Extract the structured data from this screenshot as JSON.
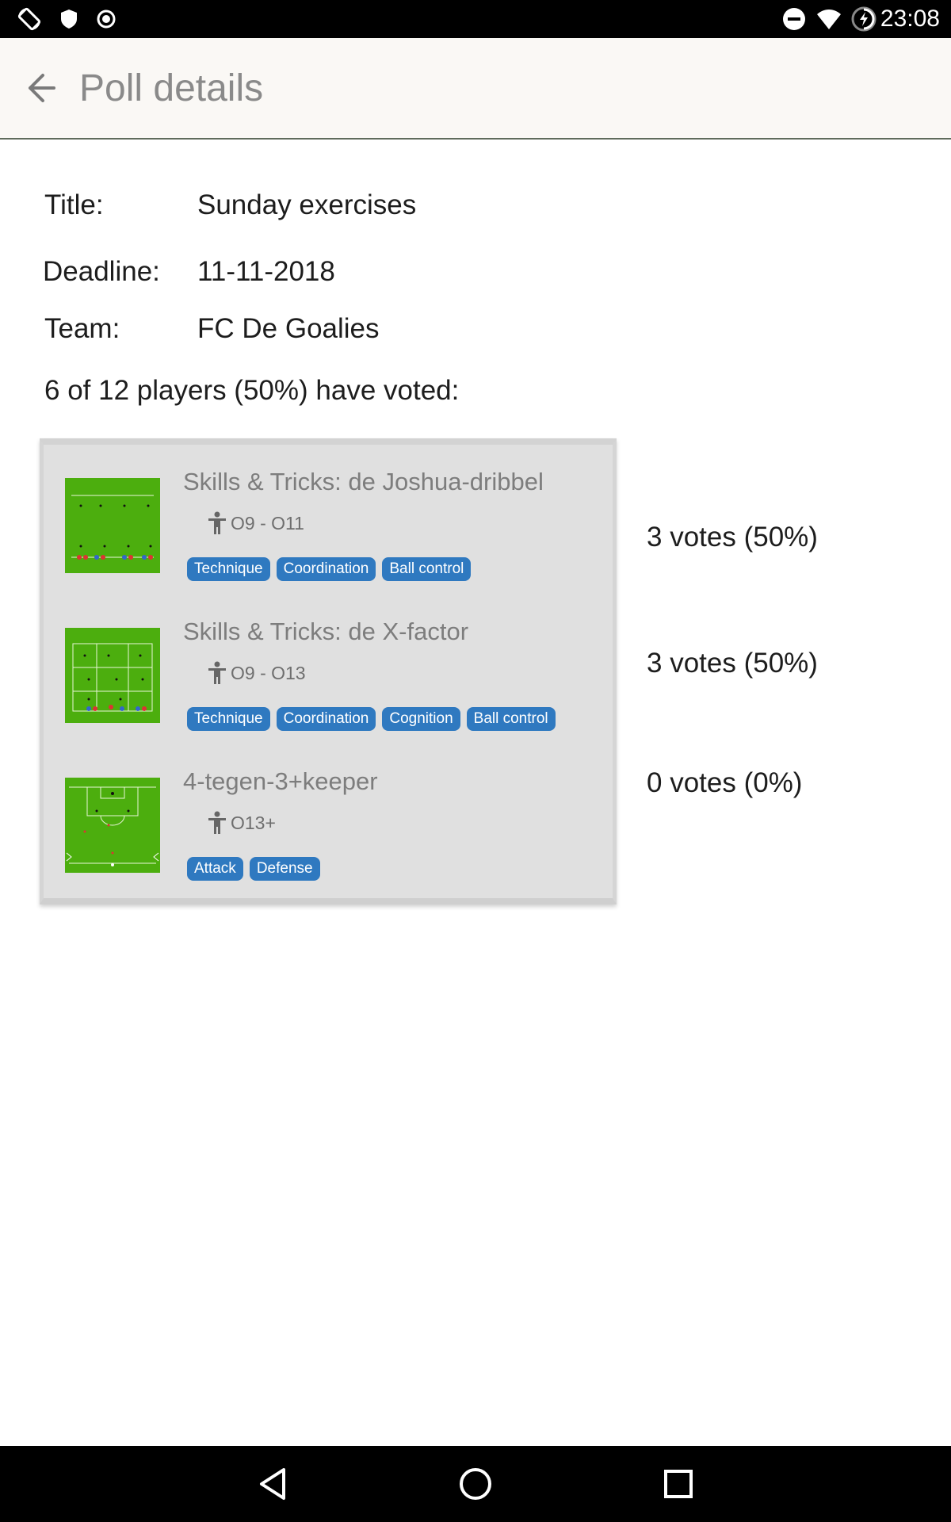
{
  "status_bar": {
    "time": "23:08",
    "icons": [
      "rotate-icon",
      "shield-icon",
      "record-icon",
      "do-not-disturb-icon",
      "wifi-icon",
      "battery-charging-icon"
    ]
  },
  "app_bar": {
    "title": "Poll details",
    "back_icon": "arrow-left-icon"
  },
  "details": {
    "title_label": "Title:",
    "title_value": "Sunday exercises",
    "deadline_label": "Deadline:",
    "deadline_value": "11-11-2018",
    "team_label": "Team:",
    "team_value": "FC De Goalies"
  },
  "summary": "6 of 12 players (50%) have voted:",
  "exercises": [
    {
      "title": "Skills & Tricks: de Joshua-dribbel",
      "age": "O9 - O11",
      "tags": [
        "Technique",
        "Coordination",
        "Ball control"
      ],
      "votes": "3 votes (50%)",
      "vote_fraction": 0.5
    },
    {
      "title": "Skills & Tricks: de X-factor",
      "age": "O9 - O13",
      "tags": [
        "Technique",
        "Coordination",
        "Cognition",
        "Ball control"
      ],
      "votes": "3 votes (50%)",
      "vote_fraction": 0.5
    },
    {
      "title": "4-tegen-3+keeper",
      "age": "O13+",
      "tags": [
        "Attack",
        "Defense"
      ],
      "votes": "0 votes (0%)",
      "vote_fraction": 0
    }
  ],
  "colors": {
    "tag_background": "#2f79c0",
    "field_green": "#4cae0e",
    "card_background": "#e0e0e0",
    "app_bar_background": "#faf8f5"
  },
  "nav_bar": {
    "icons": [
      "back-triangle-icon",
      "home-circle-icon",
      "recents-square-icon"
    ]
  }
}
